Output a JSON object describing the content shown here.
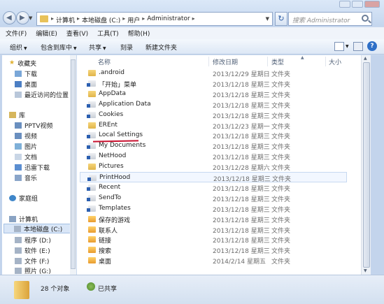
{
  "window": {
    "back_label": "◀",
    "forward_label": "▶",
    "breadcrumbs": [
      "计算机",
      "本地磁盘 (C:)",
      "用户",
      "Administrator"
    ],
    "search_placeholder": "搜索 Administrator"
  },
  "menubar": [
    "文件(F)",
    "编辑(E)",
    "查看(V)",
    "工具(T)",
    "帮助(H)"
  ],
  "toolbar": {
    "organize": "组织",
    "include_library": "包含到库中",
    "share": "共享",
    "burn": "刻录",
    "new_folder": "新建文件夹"
  },
  "navpane": {
    "favorites_header": "收藏夹",
    "favorites": [
      "下载",
      "桌面",
      "最近访问的位置"
    ],
    "libraries_header": "库",
    "libraries": [
      "PPTV视频",
      "视频",
      "图片",
      "文档",
      "迅雷下载",
      "音乐"
    ],
    "homegroup": "家庭组",
    "computer_header": "计算机",
    "drives": [
      "本地磁盘 (C:)",
      "程序 (D:)",
      "软件 (E:)",
      "文件 (F:)",
      "照片 (G:)"
    ]
  },
  "columns": {
    "name": "名称",
    "date": "修改日期",
    "type": "类型",
    "size": "大小"
  },
  "files": [
    {
      "name": ".android",
      "date": "2013/12/29 星期日",
      "type": "文件夹",
      "icon": "folder"
    },
    {
      "name": "「开始」菜单",
      "date": "2013/12/18 星期三",
      "type": "文件夹",
      "icon": "folder-link"
    },
    {
      "name": "AppData",
      "date": "2013/12/18 星期三",
      "type": "文件夹",
      "icon": "folder"
    },
    {
      "name": "Application Data",
      "date": "2013/12/18 星期三",
      "type": "文件夹",
      "icon": "folder-link"
    },
    {
      "name": "Cookies",
      "date": "2013/12/18 星期三",
      "type": "文件夹",
      "icon": "folder-link"
    },
    {
      "name": "EREnt",
      "date": "2013/12/23 星期一",
      "type": "文件夹",
      "icon": "folder"
    },
    {
      "name": "Local Settings",
      "date": "2013/12/18 星期三",
      "type": "文件夹",
      "icon": "folder-link"
    },
    {
      "name": "My Documents",
      "date": "2013/12/18 星期三",
      "type": "文件夹",
      "icon": "folder-link"
    },
    {
      "name": "NetHood",
      "date": "2013/12/18 星期三",
      "type": "文件夹",
      "icon": "folder-link"
    },
    {
      "name": "Pictures",
      "date": "2013/12/28 星期六",
      "type": "文件夹",
      "icon": "folder"
    },
    {
      "name": "PrintHood",
      "date": "2013/12/18 星期三",
      "type": "文件夹",
      "icon": "folder-link"
    },
    {
      "name": "Recent",
      "date": "2013/12/18 星期三",
      "type": "文件夹",
      "icon": "folder-link"
    },
    {
      "name": "SendTo",
      "date": "2013/12/18 星期三",
      "type": "文件夹",
      "icon": "folder-link"
    },
    {
      "name": "Templates",
      "date": "2013/12/18 星期三",
      "type": "文件夹",
      "icon": "folder-link"
    },
    {
      "name": "保存的游戏",
      "date": "2013/12/18 星期三",
      "type": "文件夹",
      "icon": "folder-special"
    },
    {
      "name": "联系人",
      "date": "2013/12/18 星期三",
      "type": "文件夹",
      "icon": "folder-special"
    },
    {
      "name": "链接",
      "date": "2013/12/18 星期三",
      "type": "文件夹",
      "icon": "folder-special"
    },
    {
      "name": "搜索",
      "date": "2013/12/18 星期三",
      "type": "文件夹",
      "icon": "folder-special"
    },
    {
      "name": "桌面",
      "date": "2014/2/14 星期五",
      "type": "文件夹",
      "icon": "folder-special"
    }
  ],
  "status": {
    "count": "28 个对象",
    "shared": "已共享"
  }
}
